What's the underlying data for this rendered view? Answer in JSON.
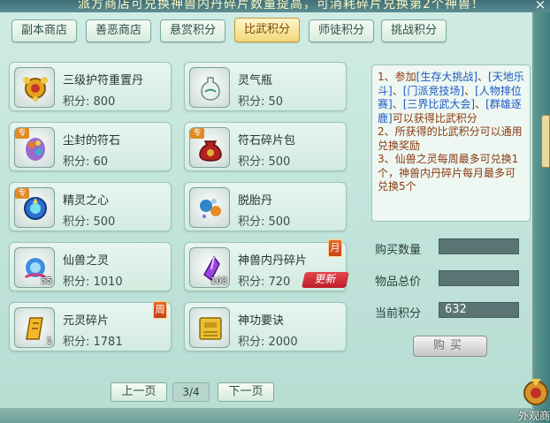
{
  "header": {
    "text": "派方商店可兑换神兽内丹碎片数量提高，可消耗碎片兑换第2个神兽！",
    "close": "×"
  },
  "tabs": [
    {
      "label": "副本商店",
      "active": false
    },
    {
      "label": "善恶商店",
      "active": false
    },
    {
      "label": "悬赏积分",
      "active": false
    },
    {
      "label": "比武积分",
      "active": true
    },
    {
      "label": "师徒积分",
      "active": false
    },
    {
      "label": "挑战积分",
      "active": false
    }
  ],
  "items": [
    {
      "name": "三级护符重置丹",
      "price": "积分: 800",
      "icon": "golden-amulet-icon"
    },
    {
      "name": "灵气瓶",
      "price": "积分: 50",
      "icon": "spirit-vase-icon"
    },
    {
      "name": "尘封的符石",
      "price": "积分: 60",
      "icon": "sealed-rune-stone-icon",
      "badge": "专"
    },
    {
      "name": "符石碎片包",
      "price": "积分: 500",
      "icon": "rune-fragment-bag-icon",
      "badge": "专"
    },
    {
      "name": "精灵之心",
      "price": "积分: 500",
      "icon": "spirit-heart-icon",
      "badge": "专"
    },
    {
      "name": "脱胎丹",
      "price": "积分: 500",
      "icon": "rebirth-pill-icon"
    },
    {
      "name": "仙兽之灵",
      "price": "积分: 1010",
      "icon": "celestial-beast-soul-icon",
      "count": "55"
    },
    {
      "name": "神兽内丹碎片",
      "price": "积分: 720",
      "icon": "beast-core-fragment-icon",
      "count": "103",
      "week": "月",
      "new": "更新"
    },
    {
      "name": "元灵碎片",
      "price": "积分: 1781",
      "icon": "yuanling-fragment-icon",
      "count": "1",
      "week": "周"
    },
    {
      "name": "神功要诀",
      "price": "积分: 2000",
      "icon": "skill-manual-icon"
    }
  ],
  "rules": {
    "p1_prefix": "1、参加",
    "p1_links": [
      "[生存大挑战]",
      "[天地乐斗]",
      "[门派竞技场]",
      "[人物排位赛]",
      "[三界比武大会]",
      "[群雄逐鹿]"
    ],
    "sep": "、",
    "p1_suffix": "可以获得比武积分",
    "p2": "2、所获得的比武积分可以通用兑换奖励",
    "p3": "3、仙兽之灵每周最多可兑换1个，神兽内丹碎片每月最多可兑换5个"
  },
  "form": {
    "qty_label": "购买数量",
    "qty_value": "",
    "total_label": "物品总价",
    "total_value": "",
    "current_label": "当前积分",
    "current_value": "632"
  },
  "buy_label": "购买",
  "pager": {
    "prev": "上一页",
    "indicator": "3/4",
    "next": "下一页"
  },
  "corner_label": "外观商",
  "colors": {
    "active_tab": "#f4d77a",
    "link": "#1a59c4",
    "rule_text": "#8a3a10",
    "new_tag": "#c8282f"
  }
}
